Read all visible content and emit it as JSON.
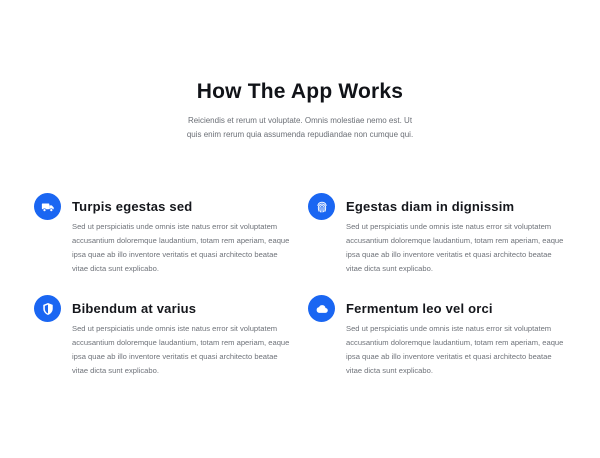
{
  "section": {
    "title": "How The App Works",
    "description": "Reiciendis et rerum ut voluptate. Omnis molestiae nemo est. Ut quis enim rerum quia assumenda repudiandae non cumque qui."
  },
  "features": [
    {
      "icon": "truck-icon",
      "title": "Turpis egestas sed",
      "text": "Sed ut perspiciatis unde omnis iste natus error sit voluptatem accusantium doloremque laudantium, totam rem aperiam, eaque ipsa quae ab illo inventore veritatis et quasi architecto beatae vitae dicta sunt explicabo."
    },
    {
      "icon": "fingerprint-icon",
      "title": "Egestas diam in dignissim",
      "text": "Sed ut perspiciatis unde omnis iste natus error sit voluptatem accusantium doloremque laudantium, totam rem aperiam, eaque ipsa quae ab illo inventore veritatis et quasi architecto beatae vitae dicta sunt explicabo."
    },
    {
      "icon": "shield-icon",
      "title": "Bibendum at varius",
      "text": "Sed ut perspiciatis unde omnis iste natus error sit voluptatem accusantium doloremque laudantium, totam rem aperiam, eaque ipsa quae ab illo inventore veritatis et quasi architecto beatae vitae dicta sunt explicabo."
    },
    {
      "icon": "cloud-icon",
      "title": "Fermentum leo vel orci",
      "text": "Sed ut perspiciatis unde omnis iste natus error sit voluptatem accusantium doloremque laudantium, totam rem aperiam, eaque ipsa quae ab illo inventore veritatis et quasi architecto beatae vitae dicta sunt explicabo."
    }
  ],
  "colors": {
    "accent": "#1a66f2",
    "heading": "#111318",
    "body_text": "#6f737a",
    "background": "#ffffff"
  }
}
